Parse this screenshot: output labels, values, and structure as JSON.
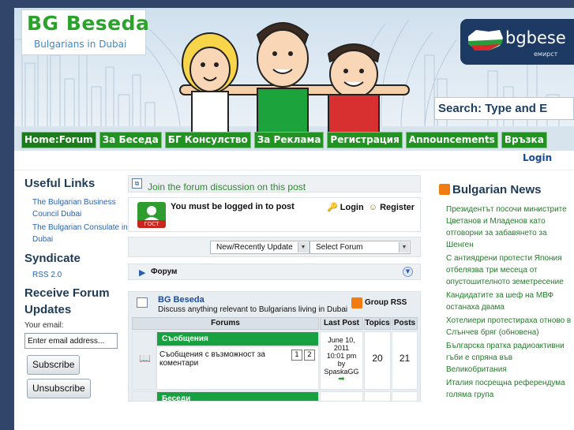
{
  "header": {
    "logo_title": "BG Beseda",
    "logo_subtitle": "Bulgarians in Dubai",
    "badge_text": "bgbese",
    "badge_sub": "емирст",
    "search_placeholder": "Search: Type and E"
  },
  "nav": {
    "items": [
      {
        "label": "Home:Forum",
        "active": true
      },
      {
        "label": "За Беседа"
      },
      {
        "label": "БГ Консулство"
      },
      {
        "label": "За Реклама"
      },
      {
        "label": "Регистрация"
      },
      {
        "label": "Announcements"
      },
      {
        "label": "Връзка"
      }
    ],
    "login": "Login"
  },
  "left": {
    "useful_links_title": "Useful Links",
    "links": [
      "The Bulgarian Business Council Dubai",
      "The Bulgarian Consulate in Dubai"
    ],
    "syndicate_title": "Syndicate",
    "rss_link": "RSS 2.0",
    "updates_title": "Receive Forum Updates",
    "email_label": "Your email:",
    "email_value": "Enter email address...",
    "subscribe": "Subscribe",
    "unsubscribe": "Unsubscribe"
  },
  "main": {
    "join_text": "Join the forum discussion on this post",
    "guest_label": "ГОСТ",
    "must_login": "You must be logged in to post",
    "login": "Login",
    "register": "Register",
    "select_recent": "New/Recently Update",
    "select_forum": "Select Forum",
    "forum_bar_title": "Форум",
    "category": {
      "title": "BG Beseda",
      "description": "Discuss anything relevant to Bulgarians living in Dubai",
      "rss": "Group RSS"
    },
    "headers": {
      "forums": "Forums",
      "last_post": "Last Post",
      "topics": "Topics",
      "posts": "Posts"
    },
    "groups": [
      {
        "name": "Съобщения",
        "forum_name": "Съобщения с възможност за коментари",
        "pages": [
          "1",
          "2"
        ],
        "last_post_date": "June 10, 2011",
        "last_post_time": "10:01 pm",
        "last_post_by": "by",
        "last_post_user": "SpaskaGG",
        "topics": "20",
        "posts": "21"
      },
      {
        "name": "Беседи"
      }
    ]
  },
  "right": {
    "title": "Bulgarian News",
    "items": [
      "Президентът посочи министрите Цветанов и Младенов като отговорни за забавянето за Шенген",
      "С антиядрени протести Япония отбелязва три месеца от опустошителното земетресение",
      "Кандидатите за шеф на МВФ останаха двама",
      "Хотелиери протестираха отново в Слънчев бряг (обновена)",
      "Българска пратка радиоактивни гъби е спряна във Великобритания",
      "Италия посрещна референдума голяма група"
    ]
  },
  "colors": {
    "nav_green": "#229322",
    "group_green": "#17a140",
    "news_green": "#237b2a",
    "frame_blue": "#31456a"
  }
}
